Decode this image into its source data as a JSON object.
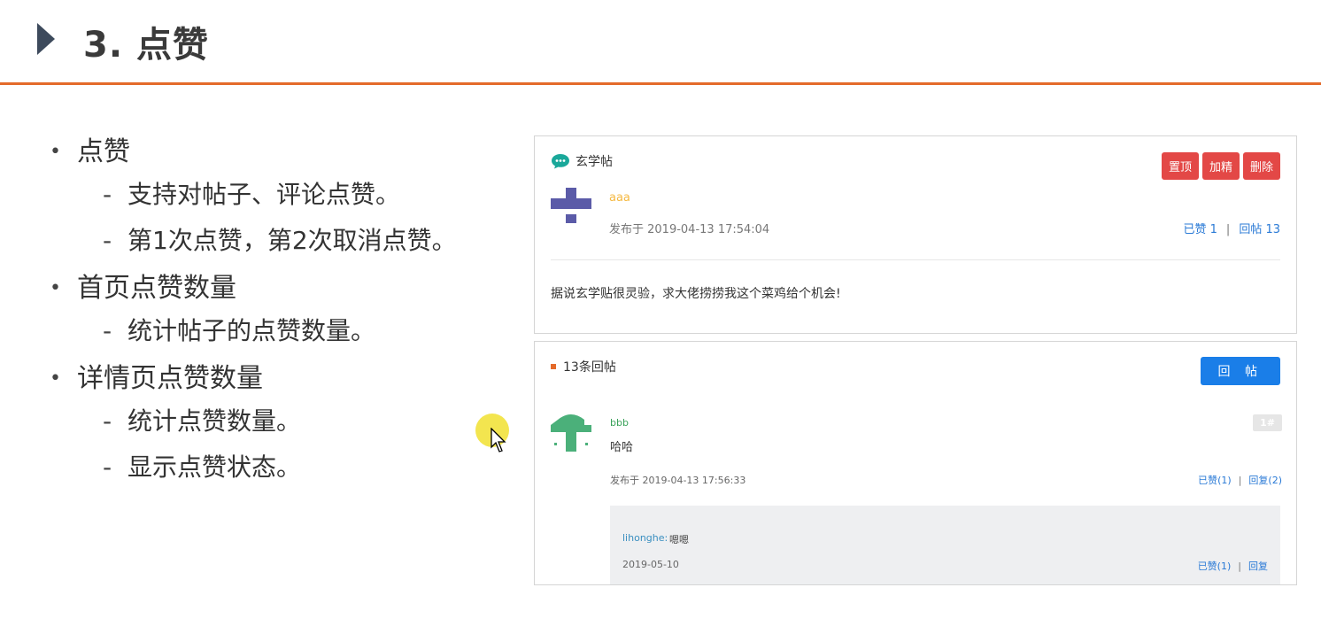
{
  "slide": {
    "title": "3. 点赞",
    "accent_color": "#e46a2a"
  },
  "bullets": [
    {
      "label": "点赞",
      "subs": [
        "支持对帖子、评论点赞。",
        "第1次点赞，第2次取消点赞。"
      ]
    },
    {
      "label": "首页点赞数量",
      "subs": [
        "统计帖子的点赞数量。"
      ]
    },
    {
      "label": "详情页点赞数量",
      "subs": [
        "统计点赞数量。",
        "显示点赞状态。"
      ]
    }
  ],
  "post": {
    "title": "玄学帖",
    "buttons": {
      "top": "置顶",
      "highlight": "加精",
      "delete": "删除"
    },
    "author": "aaa",
    "time": "发布于 2019-04-13 17:54:04",
    "likes": "已赞 1",
    "replies": "回帖 13",
    "content": "据说玄学贴很灵验，求大佬捞捞我这个菜鸡给个机会!"
  },
  "reply_section": {
    "count": "13条回帖",
    "reply_button": "回 帖",
    "reply": {
      "author": "bbb",
      "content": "哈哈",
      "floor": "1#",
      "time": "发布于 2019-04-13 17:56:33",
      "likes": "已赞(1)",
      "replies": "回复(2)",
      "comment": {
        "author": "lihonghe:",
        "content": "嗯嗯",
        "time": "2019-05-10",
        "likes": "已赞(1)",
        "reply": "回复"
      }
    }
  },
  "icons": {
    "chat": "chat-bubble-icon",
    "pointer": "mouse-pointer-icon"
  }
}
